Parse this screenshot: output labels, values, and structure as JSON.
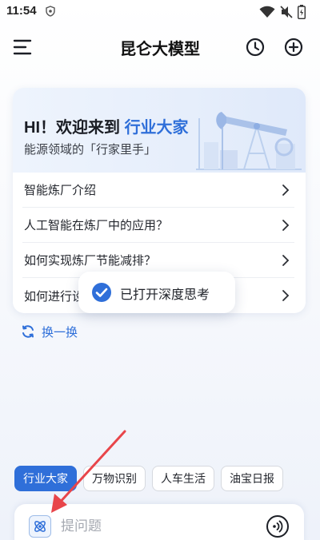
{
  "status_bar": {
    "time": "11:54",
    "icons": [
      "shield-icon",
      "wifi-icon",
      "mute-icon",
      "battery-icon"
    ]
  },
  "header": {
    "title": "昆仑大模型",
    "left_icon": "menu-icon",
    "right_icons": [
      "history-clock-icon",
      "add-circle-icon"
    ]
  },
  "welcome": {
    "greeting_prefix": "HI！欢迎来到",
    "greeting_highlight": "行业大家",
    "subtitle": "能源领域的「行家里手」",
    "illustration": "oil-pump-icon",
    "questions": [
      {
        "label": "智能炼厂介绍"
      },
      {
        "label": "人工智能在炼厂中的应用？"
      },
      {
        "label": "如何实现炼厂节能减排？"
      },
      {
        "label": "如何进行设"
      }
    ]
  },
  "toast": {
    "text": "已打开深度思考",
    "icon": "check-circle-icon"
  },
  "refresh": {
    "label": "换一换",
    "icon": "refresh-icon"
  },
  "chips": [
    {
      "label": "行业大家",
      "active": true
    },
    {
      "label": "万物识别",
      "active": false
    },
    {
      "label": "人车生活",
      "active": false
    },
    {
      "label": "油宝日报",
      "active": false
    }
  ],
  "input_bar": {
    "placeholder": "提问题",
    "deep_think_icon": "atom-icon",
    "voice_icon": "voice-wave-icon"
  },
  "colors": {
    "accent": "#2f6fd9",
    "annotation_arrow": "#e8454a"
  }
}
